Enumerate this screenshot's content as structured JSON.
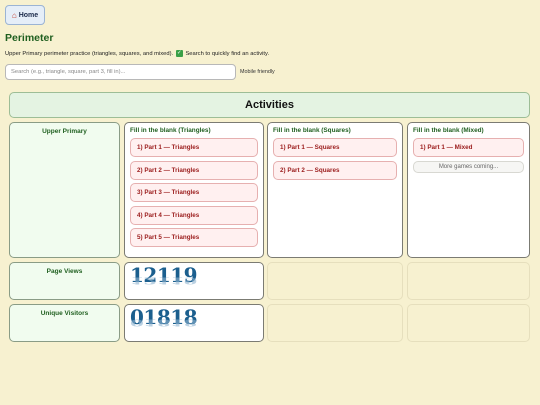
{
  "nav": {
    "home_label": "Home",
    "home_icon": "house-icon"
  },
  "page": {
    "title": "Perimeter",
    "intro_before": "Upper Primary perimeter practice (triangles, squares, and mixed).",
    "intro_after": "Search to quickly find an activity."
  },
  "search": {
    "value": "",
    "placeholder": "Search (e.g., triangle, square, part 3, fill in)...",
    "note": "Mobile friendly"
  },
  "activities": {
    "header": "Activities",
    "level_label": "Upper Primary",
    "columns": [
      {
        "title": "Fill in the blank (Triangles)",
        "items": [
          "1) Part 1 — Triangles",
          "2) Part 2 — Triangles",
          "3) Part 3 — Triangles",
          "4) Part 4 — Triangles",
          "5) Part 5 — Triangles"
        ]
      },
      {
        "title": "Fill in the blank (Squares)",
        "items": [
          "1) Part 1 — Squares",
          "2) Part 2 — Squares"
        ]
      },
      {
        "title": "Fill in the blank (Mixed)",
        "items": [
          "1) Part 1 — Mixed"
        ],
        "more_label": "More games coming..."
      }
    ]
  },
  "stats": {
    "page_views_label": "Page Views",
    "page_views_value": "12119",
    "unique_visitors_label": "Unique Visitors",
    "unique_visitors_value": "01818"
  },
  "colors": {
    "background": "#f7f1d0",
    "title_green": "#1f5f1f",
    "link_red": "#9b1c1c",
    "counter_blue": "#1b5f8e"
  }
}
